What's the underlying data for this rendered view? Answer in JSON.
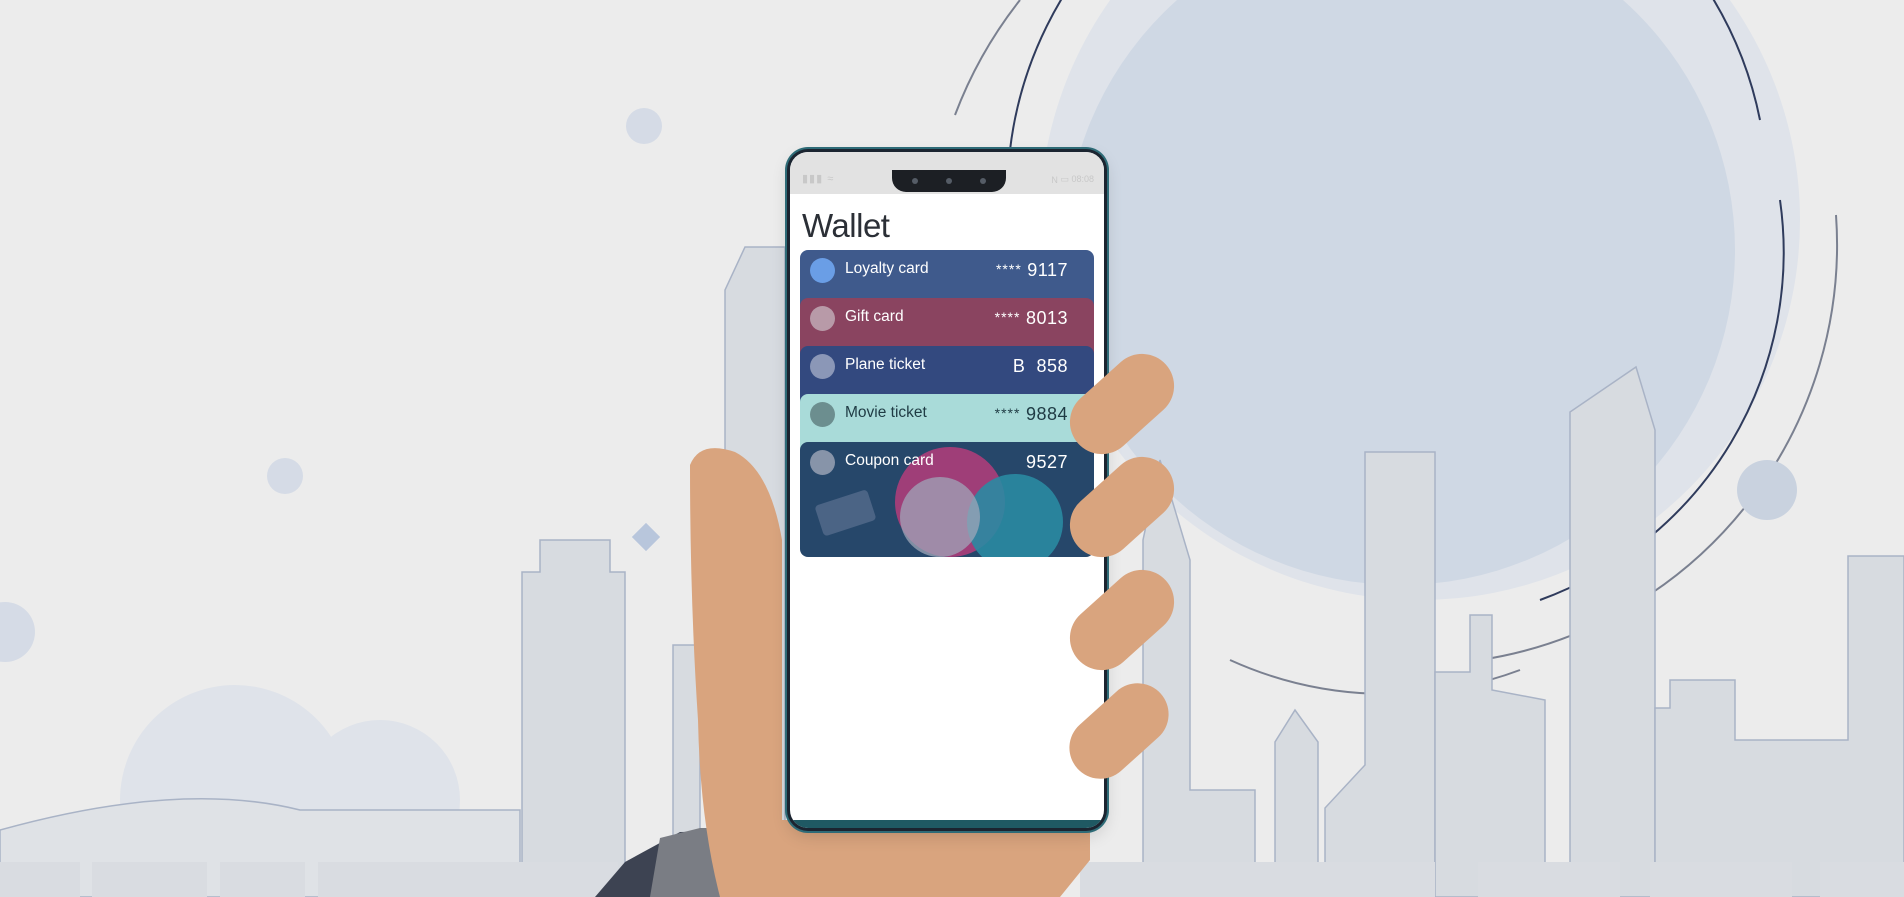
{
  "screen": {
    "title": "Wallet",
    "status_bar": {
      "time": "08:08"
    }
  },
  "cards": [
    {
      "name": "Loyalty card",
      "masked": "****",
      "number": "9117",
      "color": "#3f5a8c",
      "dot": "#6a9ee6"
    },
    {
      "name": "Gift card",
      "masked": "****",
      "number": "8013",
      "color": "#8a4460",
      "dot": "#b89aa8"
    },
    {
      "name": "Plane ticket",
      "masked": "B",
      "number": "858",
      "color": "#33497f",
      "dot": "#8b97b7"
    },
    {
      "name": "Movie ticket",
      "masked": "****",
      "number": "9884",
      "color": "#a9dbd9",
      "dot": "#6c8e8f"
    },
    {
      "name": "Coupon card",
      "masked": "",
      "number": "9527",
      "color": "#26476a",
      "dot": "#8794a9"
    }
  ],
  "icons": {
    "signal": "signal-icon",
    "wifi": "wifi-icon",
    "nfc": "nfc-icon",
    "battery": "battery-icon"
  },
  "colors": {
    "background": "#ececec",
    "skin": "#d9a47e",
    "skyline": "#d6d9de",
    "sun_circle": "#cfd8e4",
    "phone_frame": "#1b2430",
    "accent_teal": "#2e6b77"
  }
}
